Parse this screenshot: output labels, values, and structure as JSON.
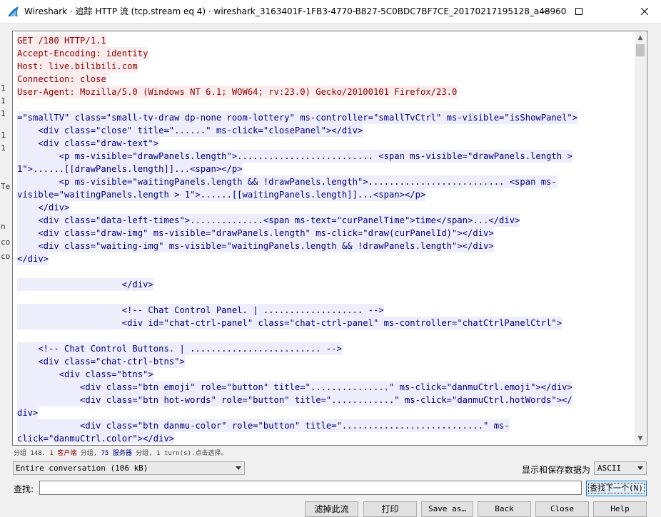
{
  "window": {
    "title": "Wireshark · 追踪 HTTP 流 (tcp.stream eq 4) · wireshark_3163401F-1FB3-4770-B827-5C0BDC7BF7CE_20170217195128_a48960",
    "min_symbol": "—",
    "max_symbol": "☐",
    "close_symbol": "✕"
  },
  "background_peek": [
    "1",
    "1",
    "1",
    "1",
    "1",
    "Te",
    "n",
    "co",
    "co"
  ],
  "stream_lines": [
    {
      "type": "client",
      "text": "GET /180 HTTP/1.1"
    },
    {
      "type": "client",
      "text": "Accept-Encoding: identity"
    },
    {
      "type": "client",
      "text": "Host: live.bilibili.com"
    },
    {
      "type": "client",
      "text": "Connection: close"
    },
    {
      "type": "client",
      "text": "User-Agent: Mozilla/5.0 (Windows NT 6.1; WOW64; rv:23.0) Gecko/20100101 Firefox/23.0"
    },
    {
      "type": "blank",
      "text": ""
    },
    {
      "type": "server",
      "text": "=\"smallTV\" class=\"small-tv-draw dp-none room-lottery\" ms-controller=\"smallTvCtrl\" ms-visible=\"isShowPanel\">"
    },
    {
      "type": "server",
      "text": "    <div class=\"close\" title=\"......\" ms-click=\"closePanel\"></div>"
    },
    {
      "type": "server",
      "text": "    <div class=\"draw-text\">"
    },
    {
      "type": "server",
      "text": "        <p ms-visible=\"drawPanels.length\">.......................... <span ms-visible=\"drawPanels.length >"
    },
    {
      "type": "server",
      "text": "1\">......[[drawPanels.length]]...<span></p>"
    },
    {
      "type": "server",
      "text": "        <p ms-visible=\"waitingPanels.length && !drawPanels.length\">.......................... <span ms-"
    },
    {
      "type": "server",
      "text": "visible=\"waitingPanels.length > 1\">......[[waitingPanels.length]]...<span></p>"
    },
    {
      "type": "server",
      "text": "    </div>"
    },
    {
      "type": "server",
      "text": "    <div class=\"data-left-times\">..............<span ms-text=\"curPanelTime\">time</span>...</div>"
    },
    {
      "type": "server",
      "text": "    <div class=\"draw-img\" ms-visible=\"drawPanels.length\" ms-click=\"draw(curPanelId)\"></div>"
    },
    {
      "type": "server",
      "text": "    <div class=\"waiting-img\" ms-visible=\"waitingPanels.length && !drawPanels.length\"></div>"
    },
    {
      "type": "server",
      "text": "</div>"
    },
    {
      "type": "blank",
      "text": ""
    },
    {
      "type": "server",
      "text": "                    </div>"
    },
    {
      "type": "blank",
      "text": ""
    },
    {
      "type": "server",
      "text": "                    <!-- Chat Control Panel. | ................... -->"
    },
    {
      "type": "server",
      "text": "                    <div id=\"chat-ctrl-panel\" class=\"chat-ctrl-panel\" ms-controller=\"chatCtrlPanelCtrl\">"
    },
    {
      "type": "blank",
      "text": ""
    },
    {
      "type": "server",
      "text": "    <!-- Chat Control Buttons. | ......................... -->"
    },
    {
      "type": "server",
      "text": "    <div class=\"chat-ctrl-btns\">"
    },
    {
      "type": "server",
      "text": "        <div class=\"btns\">"
    },
    {
      "type": "server",
      "text": "            <div class=\"btn emoji\" role=\"button\" title=\"...............\" ms-click=\"danmuCtrl.emoji\"></div>"
    },
    {
      "type": "server",
      "text": "            <div class=\"btn hot-words\" role=\"button\" title=\"............\" ms-click=\"danmuCtrl.hotWords\"></"
    },
    {
      "type": "server",
      "text": "div>"
    },
    {
      "type": "server",
      "text": "            <div class=\"btn danmu-color\" role=\"button\" title=\"...........................\" ms-"
    },
    {
      "type": "server",
      "text": "click=\"danmuCtrl.color\"></div>"
    }
  ],
  "status": {
    "prefix": "分组 148. ",
    "client_count": "1 客户端",
    "middle": " 分组, ",
    "server_count": "75 服务器",
    "suffix": " 分组, 1 turn(s).点击选择。"
  },
  "conversation_select": {
    "value": "Entire conversation (106 kB)"
  },
  "show_save_label": "显示和保存数据为",
  "format_select": {
    "value": "ASCII"
  },
  "find": {
    "label": "查找:",
    "value": "",
    "next_label": "查找下一个(N)"
  },
  "buttons": {
    "filter": "滤掉此流",
    "print": "打印",
    "save_as": "Save as…",
    "back": "Back",
    "close": "Close",
    "help": "Help"
  },
  "colors": {
    "client_fg": "#8d0000",
    "client_bg": "#fbeded",
    "server_fg": "#000082",
    "server_bg": "#ededfb",
    "accent": "#0078d7"
  }
}
